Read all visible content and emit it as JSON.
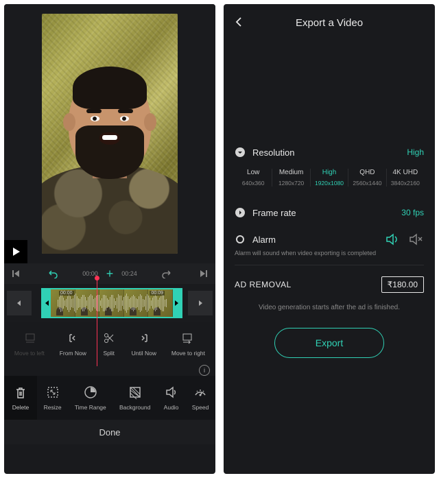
{
  "left": {
    "timeline": {
      "start": "00:00",
      "end": "00:24",
      "clip_in": "00:00",
      "clip_out": "00:09"
    },
    "trim_tools": {
      "move_left": "Move to left",
      "from_now": "From Now",
      "split": "Split",
      "until_now": "Until Now",
      "move_right": "Move to right"
    },
    "bottom_tools": {
      "delete": "Delete",
      "resize": "Resize",
      "time_range": "Time Range",
      "background": "Background",
      "audio": "Audio",
      "speed": "Speed"
    },
    "done": "Done"
  },
  "right": {
    "title": "Export a Video",
    "resolution": {
      "label": "Resolution",
      "value": "High",
      "options": [
        {
          "name": "Low",
          "dim": "640x360"
        },
        {
          "name": "Medium",
          "dim": "1280x720"
        },
        {
          "name": "High",
          "dim": "1920x1080"
        },
        {
          "name": "QHD",
          "dim": "2560x1440"
        },
        {
          "name": "4K UHD",
          "dim": "3840x2160"
        }
      ],
      "selected_index": 2
    },
    "frame_rate": {
      "label": "Frame rate",
      "value": "30 fps"
    },
    "alarm": {
      "label": "Alarm",
      "note": "Alarm will sound when video exporting is completed"
    },
    "ad_removal": {
      "label": "AD REMOVAL",
      "price": "₹180.00"
    },
    "ad_note": "Video generation starts after the ad is finished.",
    "export_label": "Export"
  }
}
